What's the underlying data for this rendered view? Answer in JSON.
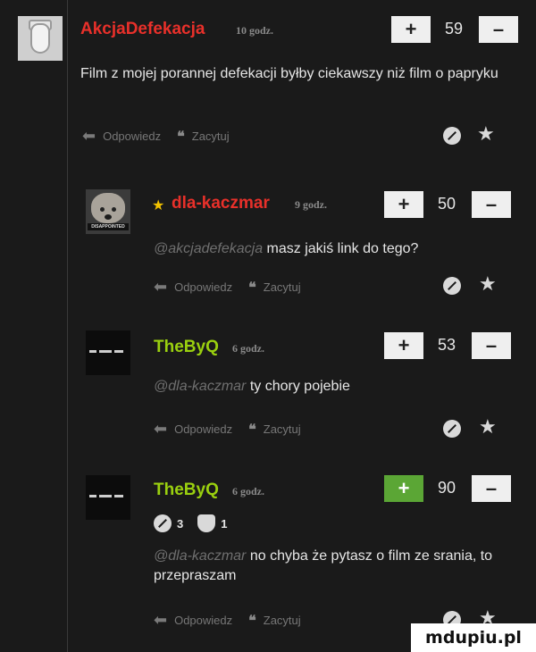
{
  "comments": [
    {
      "nick": "AkcjaDefekacja",
      "nick_color": "#e8302a",
      "time": "10 godz.",
      "votes": "59",
      "mention": "",
      "text": "Film z mojej porannej defekacji byłby ciekawszy niż film o papryku",
      "avatar": "toilet-avatar"
    },
    {
      "nick": "dla-kaczmar",
      "nick_color": "#e8302a",
      "time": "9 godz.",
      "votes": "50",
      "mention": "@akcjadefekacja",
      "text": "masz jakiś link do tego?",
      "avatar": "dog-avatar",
      "avatar_caption": "DISAPPOINTED"
    },
    {
      "nick": "TheByQ",
      "nick_color": "#9ad00f",
      "time": "6 godz.",
      "votes": "53",
      "mention": "@dla-kaczmar",
      "text": "ty chory pojebie",
      "avatar": "black-avatar"
    },
    {
      "nick": "TheByQ",
      "nick_color": "#9ad00f",
      "time": "6 godz.",
      "votes": "90",
      "mention": "@dla-kaczmar",
      "text": "no chyba że pytasz o film ze srania, to przepraszam",
      "avatar": "black-avatar",
      "reactions": [
        {
          "icon": "slash-reaction-icon",
          "count": "3"
        },
        {
          "icon": "shield-reaction-icon",
          "count": "1"
        }
      ]
    }
  ],
  "actions": {
    "reply": "Odpowiedz",
    "quote": "Zacytuj"
  },
  "vote": {
    "plus": "+",
    "minus": "–"
  },
  "icons": {
    "star": "★",
    "reply_arrow": "⬅",
    "quote_mark": "❝"
  },
  "colors": {
    "background": "#1a1a1a",
    "upvote_active": "#5ba635"
  },
  "watermark": "mdupiu.pl"
}
